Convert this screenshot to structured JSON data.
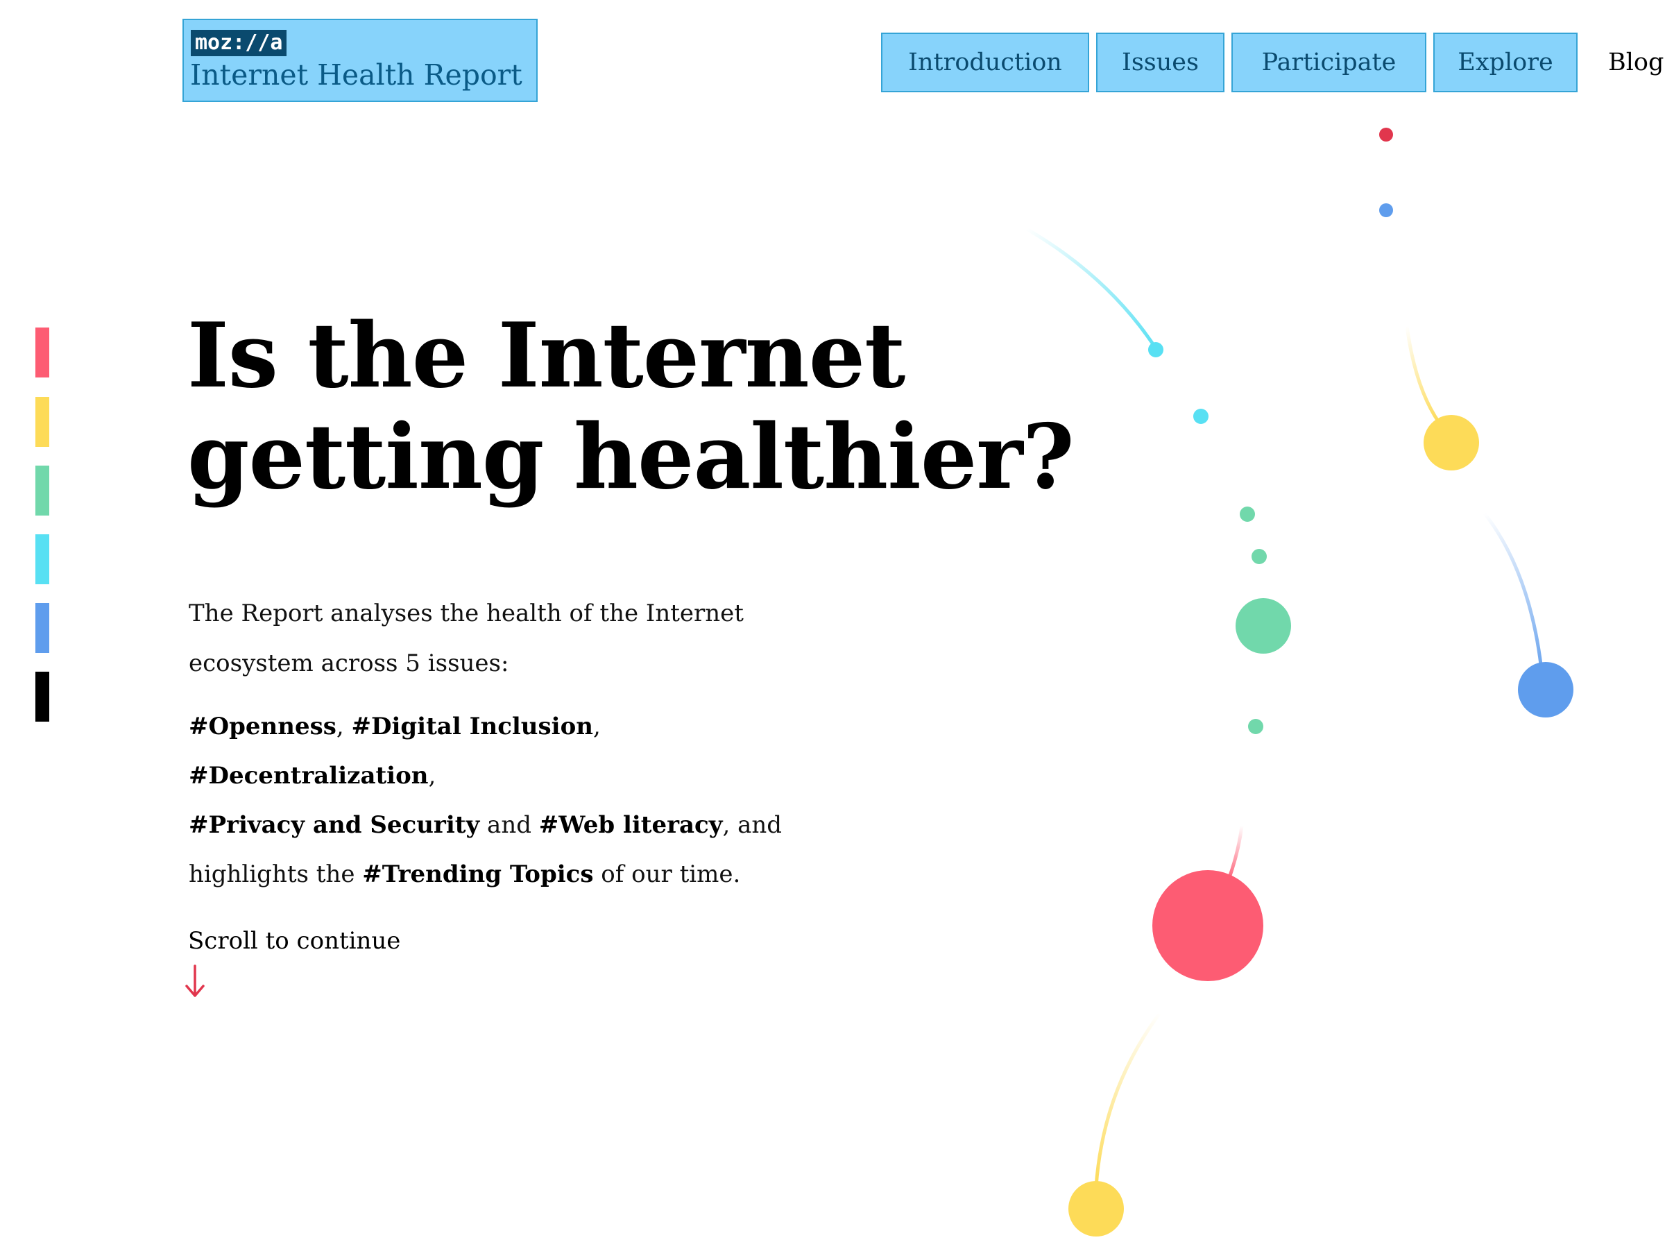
{
  "logo": {
    "wordmark": "moz://a",
    "title": "Internet Health Report"
  },
  "nav": {
    "items": [
      {
        "label": "Introduction"
      },
      {
        "label": "Issues"
      },
      {
        "label": "Participate"
      },
      {
        "label": "Explore"
      }
    ],
    "blog_label": "Blog"
  },
  "sidebar": {
    "colors": [
      "#fd5c73",
      "#fddb58",
      "#71d8ab",
      "#58e0f3",
      "#5f9ded",
      "#000000"
    ]
  },
  "hero": {
    "headline_line1": "Is the Internet",
    "headline_line2": "getting healthier?",
    "intro": "The Report analyses the health of the Internet ecosystem across 5 issues:",
    "issues": {
      "openness": "#Openness",
      "sep1": ", ",
      "digital_inclusion": "#Digital Inclusion",
      "sep2": ", ",
      "decentralization": "#Decentralization",
      "sep3": ",",
      "privacy_security": "#Privacy and Security",
      "and1": " and ",
      "web_literacy": "#Web literacy",
      "and2": ", and highlights the ",
      "trending_topics": "#Trending Topics",
      "tail": " of our time."
    },
    "scroll_label": "Scroll to continue",
    "scroll_arrow_color": "#e1364d"
  },
  "visualization": {
    "colors": {
      "red": "#fd5c73",
      "yellow": "#fddb58",
      "green": "#71d8ab",
      "cyan": "#58e0f3",
      "blue": "#5f9ded",
      "darkred": "#e1364d"
    }
  }
}
